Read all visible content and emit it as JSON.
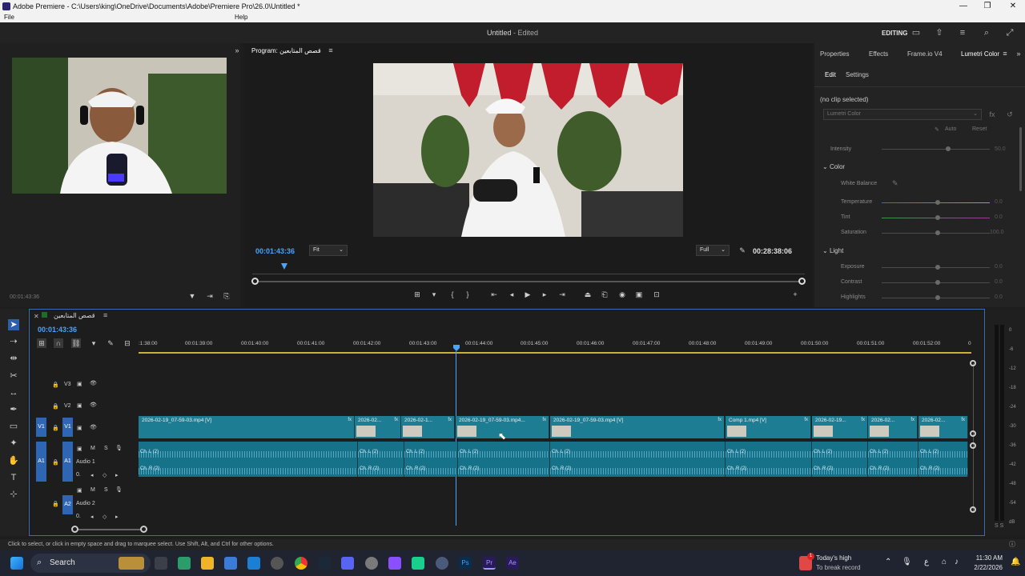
{
  "window": {
    "title": "Adobe Premiere - C:\\Users\\king\\OneDrive\\Documents\\Adobe\\Premiere Pro\\26.0\\Untitled *",
    "minimize": "—",
    "restore": "❐",
    "close": "✕"
  },
  "menu": {
    "file": "File",
    "help": "Help"
  },
  "header": {
    "project": "Untitled",
    "status": " - Edited",
    "workspace": "EDITING"
  },
  "source": {
    "timecode": "00:01:43:36"
  },
  "program": {
    "tab_label": "Program: قصص المتابعين",
    "timecode": "00:01:43:36",
    "fit": "Fit",
    "quality": "Full",
    "duration": "00:28:38:06"
  },
  "lumetri": {
    "tabs": [
      "Properties",
      "Effects",
      "Frame.io V4",
      "Lumetri Color"
    ],
    "subtabs": [
      "Edit",
      "Settings"
    ],
    "clip": "(no clip selected)",
    "effect": "Lumetri Color",
    "auto": "Auto",
    "reset": "Reset",
    "intensity": {
      "label": "Intensity",
      "value": "50.0",
      "level": 0.5
    },
    "color_section": "Color",
    "white_balance": "White Balance",
    "temperature": {
      "label": "Temperature",
      "value": "0.0",
      "level": 0.5
    },
    "tint": {
      "label": "Tint",
      "value": "0.0",
      "level": 0.5
    },
    "saturation": {
      "label": "Saturation",
      "value": "100.0",
      "level": 0.5
    },
    "light_section": "Light",
    "exposure": {
      "label": "Exposure",
      "value": "0.0",
      "level": 0.5
    },
    "contrast": {
      "label": "Contrast",
      "value": "0.0",
      "level": 0.5
    },
    "highlights": {
      "label": "Highlights",
      "value": "0.0",
      "level": 0.5
    }
  },
  "timeline": {
    "sequence": "قصص المتابعين",
    "timecode": "00:01:43:36",
    "ruler": [
      ":1:38:00",
      "00:01:39:00",
      "00:01:40:00",
      "00:01:41:00",
      "00:01:42:00",
      "00:01:43:00",
      "00:01:44:00",
      "00:01:45:00",
      "00:01:46:00",
      "00:01:47:00",
      "00:01:48:00",
      "00:01:49:00",
      "00:01:50:00",
      "00:01:51:00",
      "00:01:52:00",
      "0"
    ],
    "tracks": {
      "v3": "V3",
      "v2": "V2",
      "v1": "V1",
      "a1": "A1",
      "a2": "A2",
      "audio1": "Audio 1",
      "audio2": "Audio 2",
      "m": "M",
      "s": "S",
      "vol": "0."
    },
    "video_clips": [
      "2026-02-19_07-59-03.mp4 [V]",
      "2026-02...",
      "2026-02-1...",
      "2026-02-19_07-59-03.mp4...",
      "2026-02-19_07-59-03.mp4 [V]",
      "Comp 1.mp4 [V]",
      "2026-02-19...",
      "2026-02...",
      "2026-02..."
    ],
    "audio_l": "Ch. L (2)",
    "audio_r": "Ch. R (2)"
  },
  "meter": [
    "0",
    "-6",
    "-12",
    "-18",
    "-24",
    "-30",
    "-36",
    "-42",
    "-48",
    "-54",
    "dB"
  ],
  "meter_solo": "S  S",
  "status": "Click to select, or click in empty space and drag to marquee select. Use Shift, Alt, and Ctrl for other options.",
  "taskbar": {
    "search": "Search",
    "weather_title": "Today's high",
    "weather_sub": "To break record",
    "weather_badge": "1",
    "time": "11:30 AM",
    "date": "2/22/2026",
    "lang": "ع"
  }
}
